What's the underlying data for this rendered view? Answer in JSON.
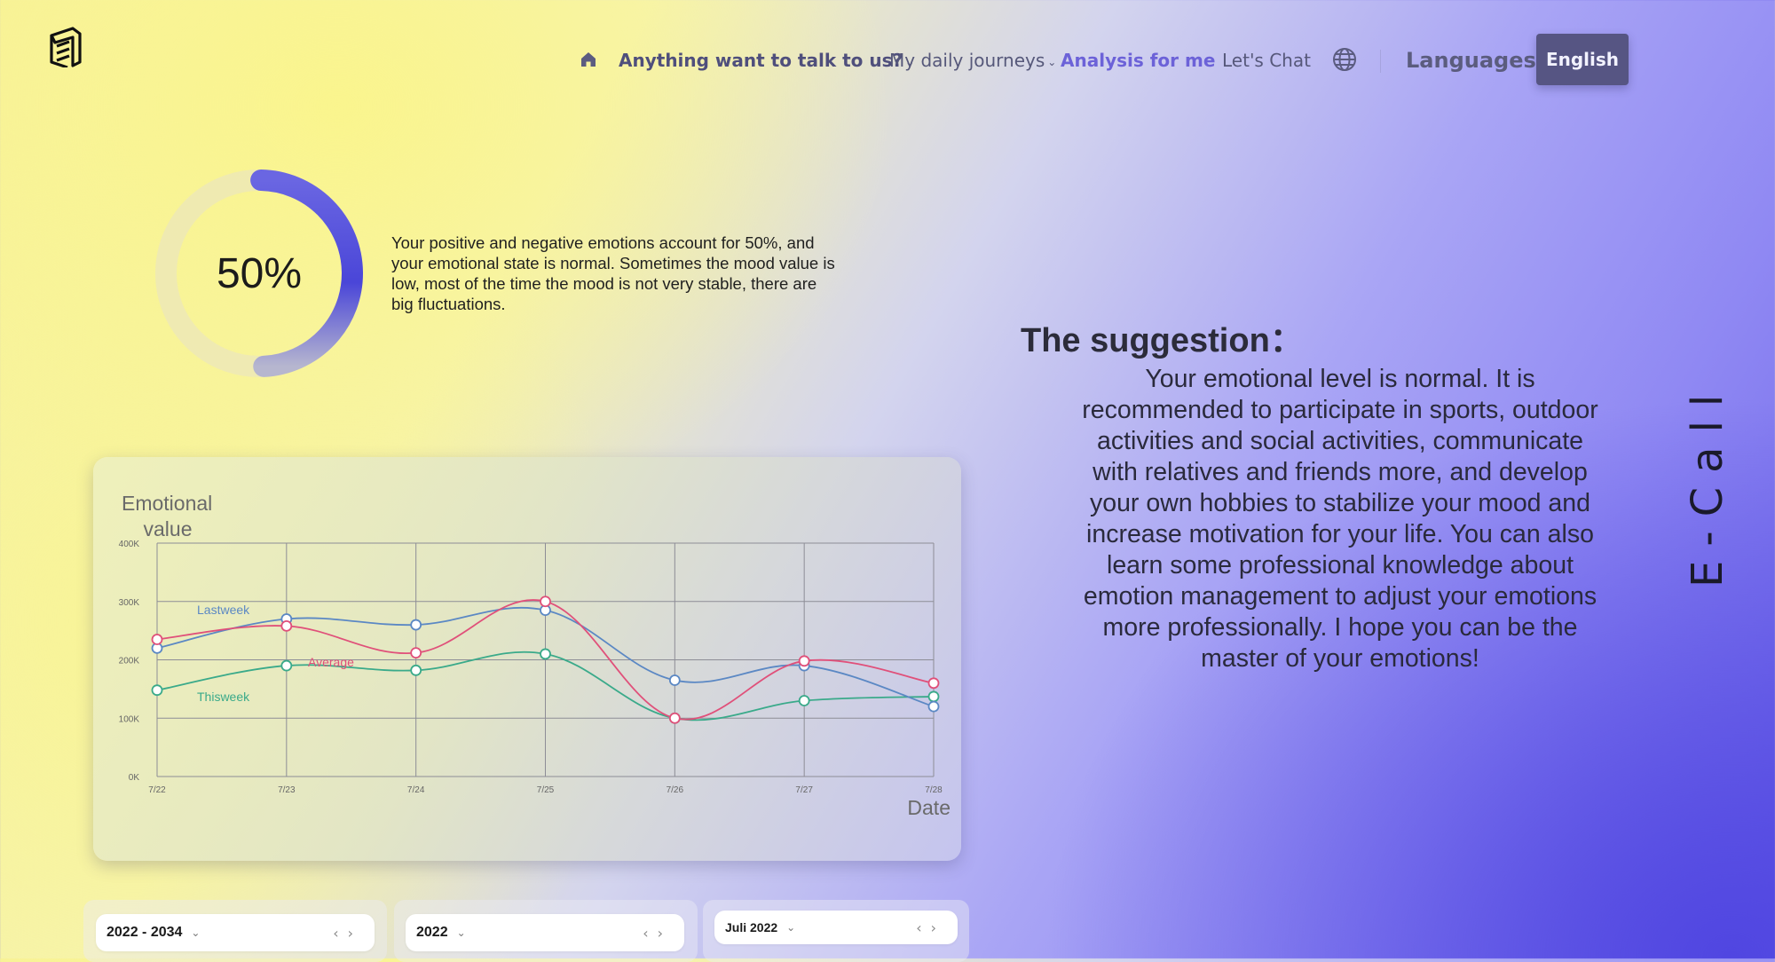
{
  "nav": {
    "home_icon": "home-icon",
    "talk": "Anything want to talk to us?",
    "journeys": "My daily journeys",
    "analysis": "Analysis for me",
    "chat": "Let's Chat",
    "globe_icon": "globe-icon",
    "languages": "Languages",
    "language_button": "English"
  },
  "summary": {
    "percent": "50%",
    "percent_value": 50,
    "text": "Your positive and negative emotions account for 50%, and your emotional state is normal. Sometimes the mood value is low, most of the time the mood is not very stable, there are big fluctuations."
  },
  "suggestion": {
    "title": "The suggestion：",
    "text": "Your emotional level is normal. It is recommended to participate in sports, outdoor activities and social activities, communicate with relatives and friends more, and develop your own hobbies to stabilize your mood and increase motivation for your life. You can also learn some professional knowledge about emotion management to adjust your emotions more professionally. I hope you can be the master of your emotions!"
  },
  "brand": "E-Call",
  "pickers": [
    {
      "value": "2022 - 2034"
    },
    {
      "value": "2022"
    },
    {
      "value": "Juli 2022"
    }
  ],
  "colors": {
    "lastweek": "#5b88c4",
    "average": "#e0507a",
    "thisweek": "#3aaa8a",
    "accent": "#6c62d8",
    "donut": "#4a46d8"
  },
  "chart_data": {
    "type": "line",
    "ylabel": "Emotional value",
    "xlabel": "Date",
    "categories": [
      "7/22",
      "7/23",
      "7/24",
      "7/25",
      "7/26",
      "7/27",
      "7/28"
    ],
    "yticks": [
      "0K",
      "100K",
      "200K",
      "300K",
      "400K"
    ],
    "ylim": [
      0,
      400
    ],
    "grid": true,
    "series": [
      {
        "name": "Lastweek",
        "values": [
          220,
          270,
          260,
          285,
          165,
          190,
          120
        ]
      },
      {
        "name": "Average",
        "values": [
          235,
          258,
          212,
          300,
          100,
          198,
          160
        ]
      },
      {
        "name": "Thisweek",
        "values": [
          148,
          190,
          182,
          210,
          100,
          130,
          137
        ]
      }
    ]
  }
}
